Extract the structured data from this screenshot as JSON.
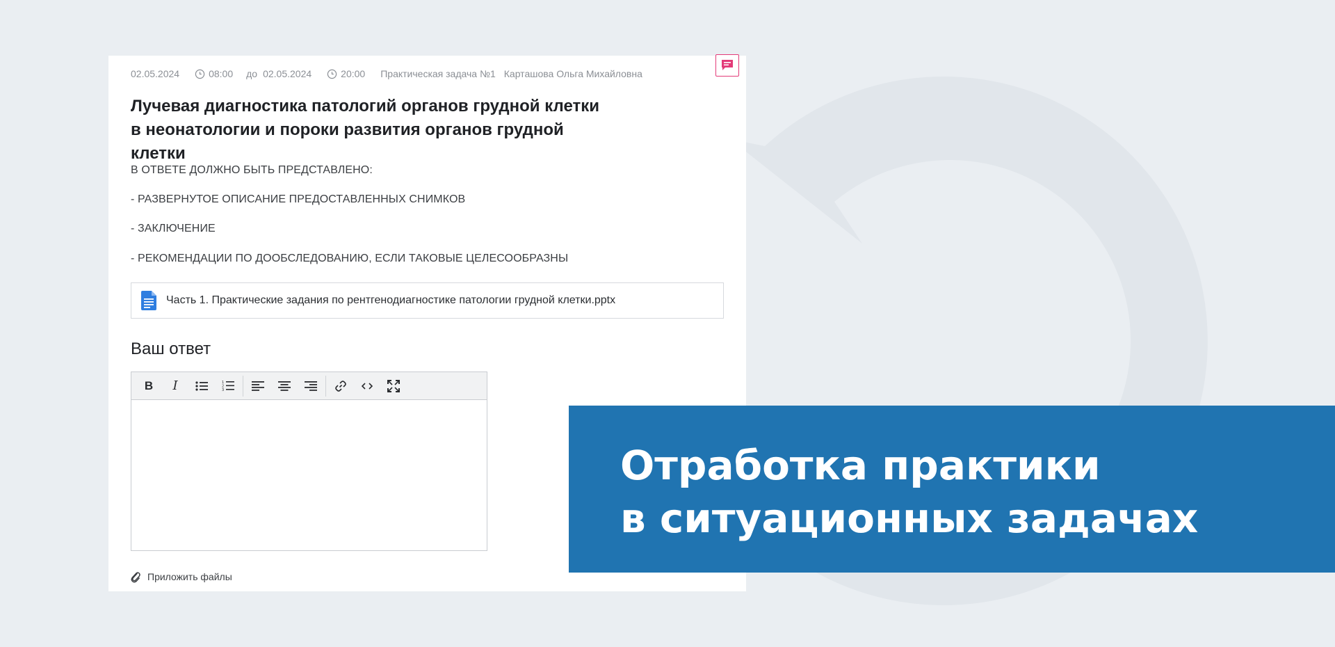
{
  "meta": {
    "start_date": "02.05.2024",
    "start_time": "08:00",
    "to_label": "до",
    "end_date": "02.05.2024",
    "end_time": "20:00",
    "task_label": "Практическая задача №1",
    "teacher": "Карташова Ольга Михайловна"
  },
  "task": {
    "title": "Лучевая диагностика патологий органов грудной клетки в неонатологии и пороки развития органов грудной клетки",
    "requirements": [
      "В ОТВЕТЕ ДОЛЖНО БЫТЬ ПРЕДСТАВЛЕНО:",
      "- РАЗВЕРНУТОЕ ОПИСАНИЕ ПРЕДОСТАВЛЕННЫХ СНИМКОВ",
      "- ЗАКЛЮЧЕНИЕ",
      "- РЕКОМЕНДАЦИИ ПО ДООБСЛЕДОВАНИЮ, ЕСЛИ ТАКОВЫЕ ЦЕЛЕСООБРАЗНЫ"
    ],
    "file_name": "Часть 1. Практические задания по рентгенодиагностике патологии грудной клетки.pptx"
  },
  "answer": {
    "label": "Ваш ответ",
    "toolbar": [
      {
        "icon": "bold-icon",
        "glyph": "B"
      },
      {
        "icon": "italic-icon",
        "glyph": "I"
      },
      {
        "icon": "bulleted-list-icon"
      },
      {
        "icon": "numbered-list-icon"
      },
      {
        "icon": "align-left-icon"
      },
      {
        "icon": "align-center-icon"
      },
      {
        "icon": "align-right-icon"
      },
      {
        "icon": "link-icon"
      },
      {
        "icon": "code-icon"
      },
      {
        "icon": "fullscreen-icon"
      }
    ],
    "attach_label": "Приложить файлы"
  },
  "banner": {
    "line1": "Отработка практики",
    "line2": "в ситуационных задачах"
  },
  "colors": {
    "background": "#eaeef2",
    "banner": "#2074b1",
    "accent_pink": "#e33a78",
    "doc_blue": "#2f7ee0"
  }
}
